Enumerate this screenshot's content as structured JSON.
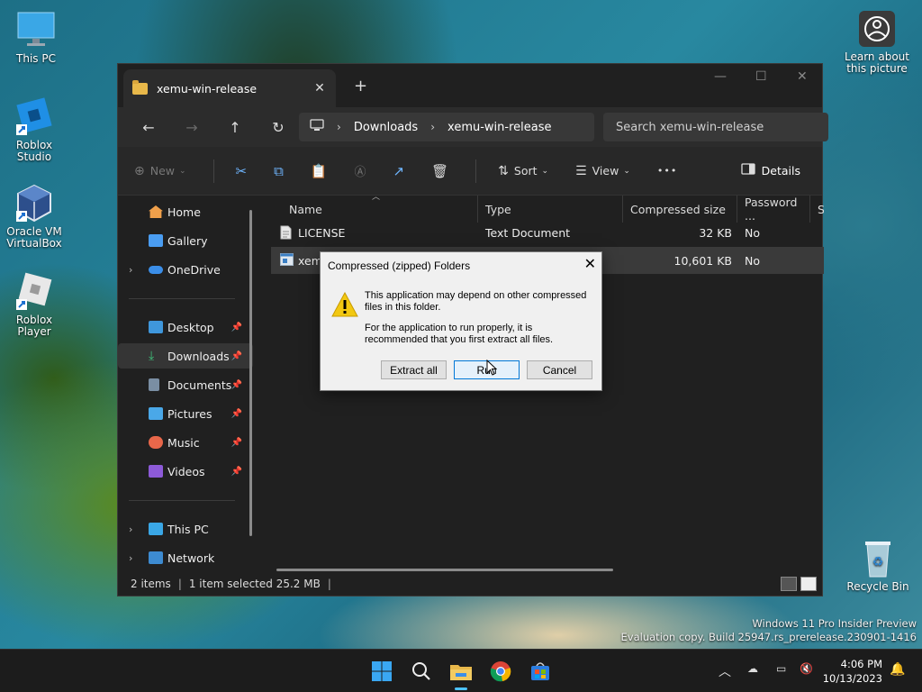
{
  "desktop": {
    "icons": [
      {
        "label": "This PC"
      },
      {
        "label": "Roblox Studio"
      },
      {
        "label": "Oracle VM VirtualBox"
      },
      {
        "label": "Roblox Player"
      },
      {
        "label": "Learn about this picture"
      },
      {
        "label": "Recycle Bin"
      }
    ],
    "watermark": {
      "line1": "Windows 11 Pro Insider Preview",
      "line2": "Evaluation copy. Build 25947.rs_prerelease.230901-1416"
    }
  },
  "explorer": {
    "tab_title": "xemu-win-release",
    "new_tab_glyph": "+",
    "breadcrumb": [
      "Downloads",
      "xemu-win-release"
    ],
    "search_placeholder": "Search xemu-win-release",
    "toolbar": {
      "new_label": "New",
      "sort_label": "Sort",
      "view_label": "View",
      "more_label": "•••",
      "details_label": "Details"
    },
    "sidebar": {
      "home": "Home",
      "gallery": "Gallery",
      "onedrive": "OneDrive",
      "desktop": "Desktop",
      "downloads": "Downloads",
      "documents": "Documents",
      "pictures": "Pictures",
      "music": "Music",
      "videos": "Videos",
      "thispc": "This PC",
      "network": "Network"
    },
    "columns": {
      "name": "Name",
      "type": "Type",
      "compressed_size": "Compressed size",
      "password": "Password ...",
      "size": "Si"
    },
    "files": [
      {
        "name": "LICENSE",
        "type": "Text Document",
        "compressed_size": "32 KB",
        "password": "No"
      },
      {
        "name": "xemu",
        "type": "",
        "compressed_size": "10,601 KB",
        "password": "No"
      }
    ],
    "status": {
      "items": "2 items",
      "selected": "1 item selected  25.2 MB"
    }
  },
  "dialog": {
    "title": "Compressed (zipped) Folders",
    "close_glyph": "✕",
    "message1": "This application may depend on other compressed files in this folder.",
    "message2": "For the application to run properly, it is recommended that you first extract all files.",
    "buttons": {
      "extract": "Extract all",
      "run": "Run",
      "cancel": "Cancel"
    }
  },
  "taskbar": {
    "time": "4:06 PM",
    "date": "10/13/2023"
  },
  "colors": {
    "accent": "#4cc2ff",
    "folder": "#e8b84a",
    "warning": "#f2c811"
  }
}
